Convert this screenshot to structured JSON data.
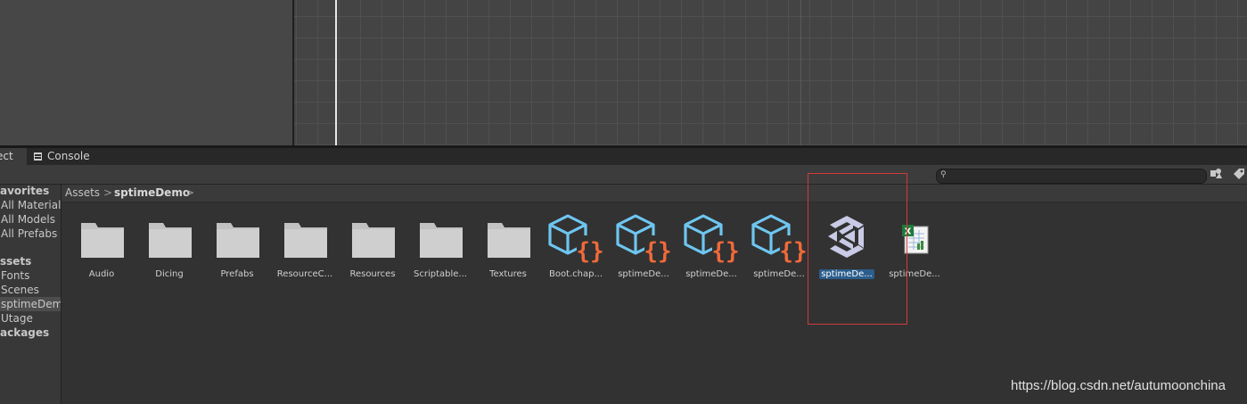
{
  "tabs": {
    "project": "ect",
    "console": "Console"
  },
  "search": {
    "placeholder": ""
  },
  "tree": {
    "favorites": "avorites",
    "all_materials": "All Materials",
    "all_models": "All Models",
    "all_prefabs": "All Prefabs",
    "assets": "ssets",
    "fonts": "Fonts",
    "scenes": "Scenes",
    "sptimedemo": "sptimeDemo",
    "utage": "Utage",
    "packages": "ackages"
  },
  "breadcrumb": {
    "root": "Assets",
    "separator": ">",
    "current": "sptimeDemo",
    "trailing": ">"
  },
  "assets": [
    {
      "label": "Audio",
      "type": "folder"
    },
    {
      "label": "Dicing",
      "type": "folder"
    },
    {
      "label": "Prefabs",
      "type": "folder"
    },
    {
      "label": "ResourceC...",
      "type": "folder"
    },
    {
      "label": "Resources",
      "type": "folder"
    },
    {
      "label": "Scriptable...",
      "type": "folder"
    },
    {
      "label": "Textures",
      "type": "folder"
    },
    {
      "label": "Boot.chap...",
      "type": "scriptable-object"
    },
    {
      "label": "sptimeDe...",
      "type": "scriptable-object"
    },
    {
      "label": "sptimeDe...",
      "type": "scriptable-object"
    },
    {
      "label": "sptimeDe...",
      "type": "scriptable-object"
    },
    {
      "label": "sptimeDe...",
      "type": "unity-scene",
      "selected": true
    },
    {
      "label": "sptimeDe...",
      "type": "excel-file"
    }
  ],
  "colors": {
    "accent_blue": "#6ec6f0",
    "accent_orange": "#f06a3a",
    "selection": "#2b5d8c",
    "highlight_box": "#d23a3a"
  },
  "watermark": "https://blog.csdn.net/autumoonchina"
}
